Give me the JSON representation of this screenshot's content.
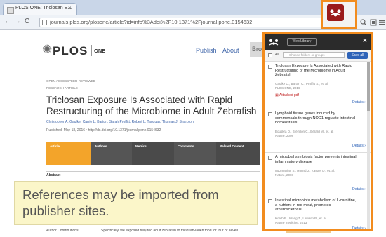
{
  "browser": {
    "tab_title": "PLOS ONE: Triclosan E...",
    "url": "journals.plos.org/plosone/article?id=info%3Adoi%2F10.1371%2Fjournal.pone.0154632"
  },
  "plos": {
    "logo": "PLOS",
    "journal": "ONE",
    "nav": [
      "Publish",
      "About",
      "Brow"
    ],
    "badges": [
      "OPEN ACCESS",
      "PEER-REVIEWED"
    ],
    "article_type": "RESEARCH ARTICLE",
    "title": "Triclosan Exposure Is Associated with Rapid Restructuring of the Microbiome in Adult Zebrafish",
    "authors": "Christopher A. Gaulke, Carrie L. Barton, Sarah Proffitt, Robert L. Tanguay, Thomas J. Sharpton",
    "published": "Published: May 18, 2016 • http://dx.doi.org/10.1371/journal.pone.0154632",
    "tabs": [
      "Article",
      "Authors",
      "Metrics",
      "Comments",
      "Related Content"
    ],
    "abstract_label": "Abstract",
    "bottom_text": "Specifically, we exposed fully-fed adult zebrafish to triclosan-laden food for four or seven",
    "bottom_left": "Author Contributions",
    "bottom_badge": "Microbial Ecology"
  },
  "mendeley": {
    "web_library": "Web Library",
    "all_label": "All",
    "select_placeholder": "Choose folders or groups",
    "save_all": "Save all",
    "details_label": "Details",
    "attached_pdf": "Attached pdf",
    "items": [
      {
        "title": "Triclosan Exposure Is Associated with Rapid Restructuring of the Microbiome in Adult Zebrafish",
        "meta1": "Gaulke C., Barton C., Proffitt S., et. al.",
        "meta2": "PLOS ONE, 2016",
        "pdf": true
      },
      {
        "title": "Lymphoid tissue genes induced by commensals through NOD1 regulate intestinal homeostasis",
        "meta1": "Bouskra D., Brézillon C., Bérard M., et. al.",
        "meta2": "Nature, 2008",
        "pdf": false
      },
      {
        "title": "A microbial symbiosis factor prevents intestinal inflammatory disease",
        "meta1": "Mazmanian S., Round J., Kasper D., et. al.",
        "meta2": "Nature, 2008",
        "pdf": false
      },
      {
        "title": "Intestinal microbiota metabolism of L-carnitine, a nutrient in red meat, promotes atherosclerosis",
        "meta1": "Koeth R., Wang Z., Levison B., et. al.",
        "meta2": "Nature medicine, 2013",
        "pdf": false
      }
    ]
  },
  "caption": {
    "text": "References may be imported from publisher sites."
  },
  "colors": {
    "accent_orange": "#f28c1e",
    "mendeley_red": "#9b1b1b",
    "link_blue": "#2e63b8",
    "caption_bg": "#fbf6c9"
  }
}
